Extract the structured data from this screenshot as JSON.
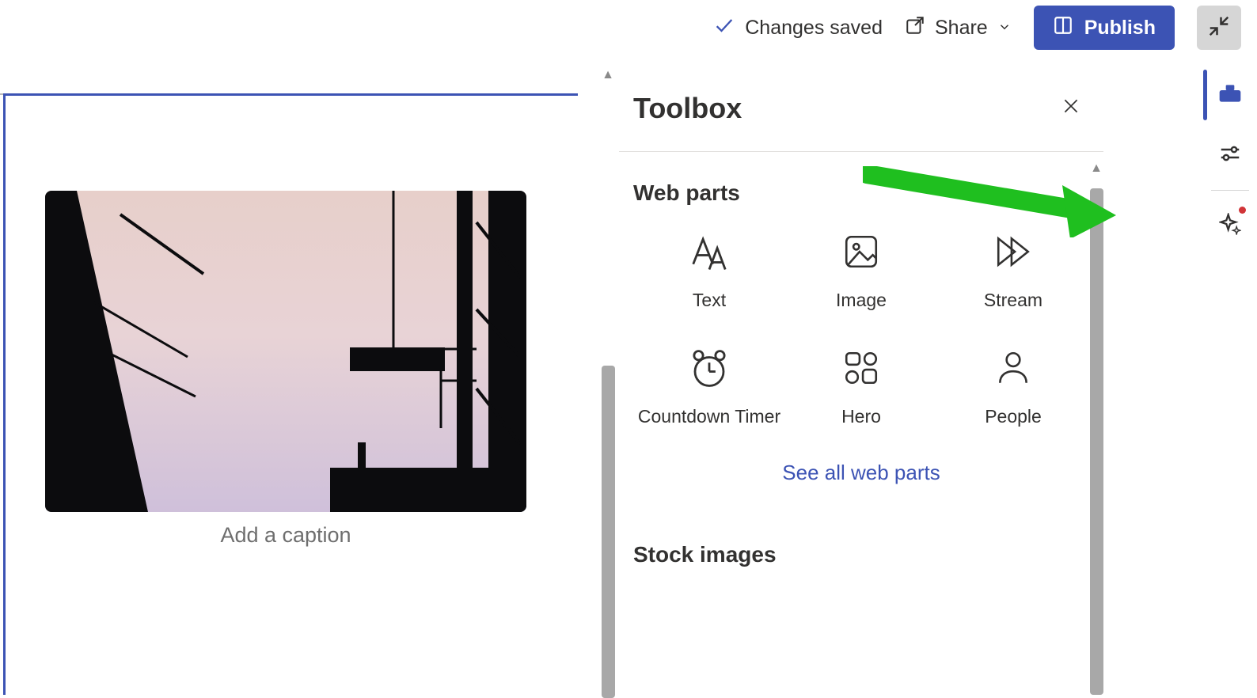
{
  "topbar": {
    "status": "Changes saved",
    "share": "Share",
    "publish": "Publish"
  },
  "canvas": {
    "caption_placeholder": "Add a caption"
  },
  "toolbox": {
    "title": "Toolbox",
    "section_webparts": "Web parts",
    "items": [
      {
        "name": "Text",
        "icon": "text"
      },
      {
        "name": "Image",
        "icon": "image"
      },
      {
        "name": "Stream",
        "icon": "stream"
      },
      {
        "name": "Countdown Timer",
        "icon": "clock"
      },
      {
        "name": "Hero",
        "icon": "hero"
      },
      {
        "name": "People",
        "icon": "people"
      }
    ],
    "see_all": "See all web parts",
    "section_stock": "Stock images"
  },
  "rail": {
    "toolbox": "Toolbox",
    "properties": "Properties",
    "copilot": "Copilot"
  }
}
